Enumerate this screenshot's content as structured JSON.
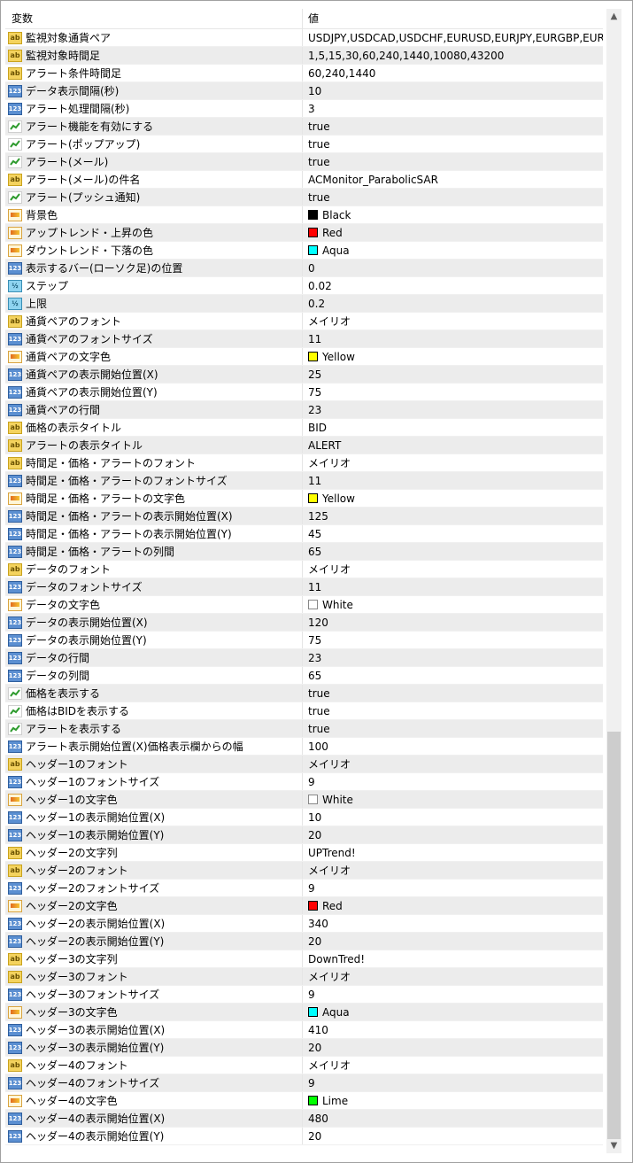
{
  "header": {
    "col_name": "変数",
    "col_value": "値"
  },
  "rows": [
    {
      "icon": "ab",
      "name": "監視対象通貨ペア",
      "value": "USDJPY,USDCAD,USDCHF,EURUSD,EURJPY,EURGBP,EURCAD,..."
    },
    {
      "icon": "ab",
      "name": "監視対象時間足",
      "value": "1,5,15,30,60,240,1440,10080,43200"
    },
    {
      "icon": "ab",
      "name": "アラート条件時間足",
      "value": "60,240,1440"
    },
    {
      "icon": "num",
      "name": "データ表示間隔(秒)",
      "value": "10"
    },
    {
      "icon": "num",
      "name": "アラート処理間隔(秒)",
      "value": "3"
    },
    {
      "icon": "bool",
      "name": "アラート機能を有効にする",
      "value": "true"
    },
    {
      "icon": "bool",
      "name": "アラート(ポップアップ)",
      "value": "true"
    },
    {
      "icon": "bool",
      "name": "アラート(メール)",
      "value": "true"
    },
    {
      "icon": "ab",
      "name": "アラート(メール)の件名",
      "value": "ACMonitor_ParabolicSAR"
    },
    {
      "icon": "bool",
      "name": "アラート(プッシュ通知)",
      "value": "true"
    },
    {
      "icon": "col",
      "name": "背景色",
      "value": "Black",
      "swatch": "#000000"
    },
    {
      "icon": "col",
      "name": "アップトレンド・上昇の色",
      "value": "Red",
      "swatch": "#ff0000"
    },
    {
      "icon": "col",
      "name": "ダウントレンド・下落の色",
      "value": "Aqua",
      "swatch": "#00ffff"
    },
    {
      "icon": "num",
      "name": "表示するバー(ローソク足)の位置",
      "value": "0"
    },
    {
      "icon": "dbl",
      "name": "ステップ",
      "value": "0.02"
    },
    {
      "icon": "dbl",
      "name": "上限",
      "value": "0.2"
    },
    {
      "icon": "ab",
      "name": "通貨ペアのフォント",
      "value": "メイリオ"
    },
    {
      "icon": "num",
      "name": "通貨ペアのフォントサイズ",
      "value": "11"
    },
    {
      "icon": "col",
      "name": "通貨ペアの文字色",
      "value": "Yellow",
      "swatch": "#ffff00"
    },
    {
      "icon": "num",
      "name": "通貨ペアの表示開始位置(X)",
      "value": "25"
    },
    {
      "icon": "num",
      "name": "通貨ペアの表示開始位置(Y)",
      "value": "75"
    },
    {
      "icon": "num",
      "name": "通貨ペアの行間",
      "value": "23"
    },
    {
      "icon": "ab",
      "name": "価格の表示タイトル",
      "value": "BID"
    },
    {
      "icon": "ab",
      "name": "アラートの表示タイトル",
      "value": "ALERT"
    },
    {
      "icon": "ab",
      "name": "時間足・価格・アラートのフォント",
      "value": "メイリオ"
    },
    {
      "icon": "num",
      "name": "時間足・価格・アラートのフォントサイズ",
      "value": "11"
    },
    {
      "icon": "col",
      "name": "時間足・価格・アラートの文字色",
      "value": "Yellow",
      "swatch": "#ffff00"
    },
    {
      "icon": "num",
      "name": "時間足・価格・アラートの表示開始位置(X)",
      "value": "125"
    },
    {
      "icon": "num",
      "name": "時間足・価格・アラートの表示開始位置(Y)",
      "value": "45"
    },
    {
      "icon": "num",
      "name": "時間足・価格・アラートの列間",
      "value": "65"
    },
    {
      "icon": "ab",
      "name": "データのフォント",
      "value": "メイリオ"
    },
    {
      "icon": "num",
      "name": "データのフォントサイズ",
      "value": "11"
    },
    {
      "icon": "col",
      "name": "データの文字色",
      "value": "White",
      "swatch": "#ffffff"
    },
    {
      "icon": "num",
      "name": "データの表示開始位置(X)",
      "value": "120"
    },
    {
      "icon": "num",
      "name": "データの表示開始位置(Y)",
      "value": "75"
    },
    {
      "icon": "num",
      "name": "データの行間",
      "value": "23"
    },
    {
      "icon": "num",
      "name": "データの列間",
      "value": "65"
    },
    {
      "icon": "bool",
      "name": "価格を表示する",
      "value": "true"
    },
    {
      "icon": "bool",
      "name": "価格はBIDを表示する",
      "value": "true"
    },
    {
      "icon": "bool",
      "name": "アラートを表示する",
      "value": "true"
    },
    {
      "icon": "num",
      "name": "アラート表示開始位置(X)価格表示欄からの幅",
      "value": "100"
    },
    {
      "icon": "ab",
      "name": "ヘッダー1のフォント",
      "value": "メイリオ"
    },
    {
      "icon": "num",
      "name": "ヘッダー1のフォントサイズ",
      "value": "9"
    },
    {
      "icon": "col",
      "name": "ヘッダー1の文字色",
      "value": "White",
      "swatch": "#ffffff"
    },
    {
      "icon": "num",
      "name": "ヘッダー1の表示開始位置(X)",
      "value": "10"
    },
    {
      "icon": "num",
      "name": "ヘッダー1の表示開始位置(Y)",
      "value": "20"
    },
    {
      "icon": "ab",
      "name": "ヘッダー2の文字列",
      "value": "UPTrend!"
    },
    {
      "icon": "ab",
      "name": "ヘッダー2のフォント",
      "value": "メイリオ"
    },
    {
      "icon": "num",
      "name": "ヘッダー2のフォントサイズ",
      "value": "9"
    },
    {
      "icon": "col",
      "name": "ヘッダー2の文字色",
      "value": "Red",
      "swatch": "#ff0000"
    },
    {
      "icon": "num",
      "name": "ヘッダー2の表示開始位置(X)",
      "value": "340"
    },
    {
      "icon": "num",
      "name": "ヘッダー2の表示開始位置(Y)",
      "value": "20"
    },
    {
      "icon": "ab",
      "name": "ヘッダー3の文字列",
      "value": "DownTred!"
    },
    {
      "icon": "ab",
      "name": "ヘッダー3のフォント",
      "value": "メイリオ"
    },
    {
      "icon": "num",
      "name": "ヘッダー3のフォントサイズ",
      "value": "9"
    },
    {
      "icon": "col",
      "name": "ヘッダー3の文字色",
      "value": "Aqua",
      "swatch": "#00ffff"
    },
    {
      "icon": "num",
      "name": "ヘッダー3の表示開始位置(X)",
      "value": "410"
    },
    {
      "icon": "num",
      "name": "ヘッダー3の表示開始位置(Y)",
      "value": "20"
    },
    {
      "icon": "ab",
      "name": "ヘッダー4のフォント",
      "value": "メイリオ"
    },
    {
      "icon": "num",
      "name": "ヘッダー4のフォントサイズ",
      "value": "9"
    },
    {
      "icon": "col",
      "name": "ヘッダー4の文字色",
      "value": "Lime",
      "swatch": "#00ff00"
    },
    {
      "icon": "num",
      "name": "ヘッダー4の表示開始位置(X)",
      "value": "480"
    },
    {
      "icon": "num",
      "name": "ヘッダー4の表示開始位置(Y)",
      "value": "20"
    }
  ]
}
